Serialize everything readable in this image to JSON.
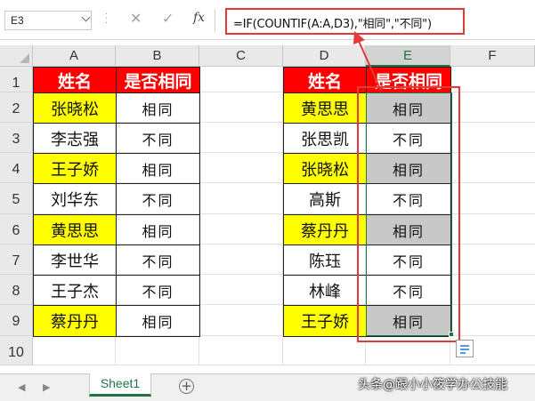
{
  "formula_bar": {
    "name_box": "E3",
    "cancel_icon": "✕",
    "enter_icon": "✓",
    "fx_label": "fx",
    "formula": "=IF(COUNTIF(A:A,D3),\"相同\",\"不同\")"
  },
  "columns": [
    "A",
    "B",
    "C",
    "D",
    "E",
    "F"
  ],
  "rows": [
    "1",
    "2",
    "3",
    "4",
    "5",
    "6",
    "7",
    "8",
    "9",
    "10"
  ],
  "table_left": {
    "header": [
      "姓名",
      "是否相同"
    ],
    "rows": [
      {
        "name": "张晓松",
        "result": "相同",
        "highlight": true
      },
      {
        "name": "李志强",
        "result": "不同",
        "highlight": false
      },
      {
        "name": "王子娇",
        "result": "相同",
        "highlight": true
      },
      {
        "name": "刘华东",
        "result": "不同",
        "highlight": false
      },
      {
        "name": "黄思思",
        "result": "相同",
        "highlight": true
      },
      {
        "name": "李世华",
        "result": "不同",
        "highlight": false
      },
      {
        "name": "王子杰",
        "result": "不同",
        "highlight": false
      },
      {
        "name": "蔡丹丹",
        "result": "相同",
        "highlight": true
      }
    ]
  },
  "table_right": {
    "header": [
      "姓名",
      "是否相同"
    ],
    "rows": [
      {
        "name": "黄思思",
        "result": "相同",
        "highlight": true
      },
      {
        "name": "张思凯",
        "result": "不同",
        "highlight": false
      },
      {
        "name": "张晓松",
        "result": "相同",
        "highlight": true
      },
      {
        "name": "高斯",
        "result": "不同",
        "highlight": false
      },
      {
        "name": "蔡丹丹",
        "result": "相同",
        "highlight": true
      },
      {
        "name": "陈珏",
        "result": "不同",
        "highlight": false
      },
      {
        "name": "林峰",
        "result": "不同",
        "highlight": false
      },
      {
        "name": "王子娇",
        "result": "相同",
        "highlight": true
      }
    ]
  },
  "sheet_tabs": {
    "active": "Sheet1",
    "prev_icon": "◀",
    "next_icon": "▶",
    "add_icon": "+"
  },
  "watermark": "头条@跟小小筱学办公技能",
  "colors": {
    "header_fill": "#ff0000",
    "highlight_fill": "#ffff00",
    "selection_fill": "#c8c8c8",
    "selection_border": "#217346",
    "annotation": "#e23a3a"
  }
}
